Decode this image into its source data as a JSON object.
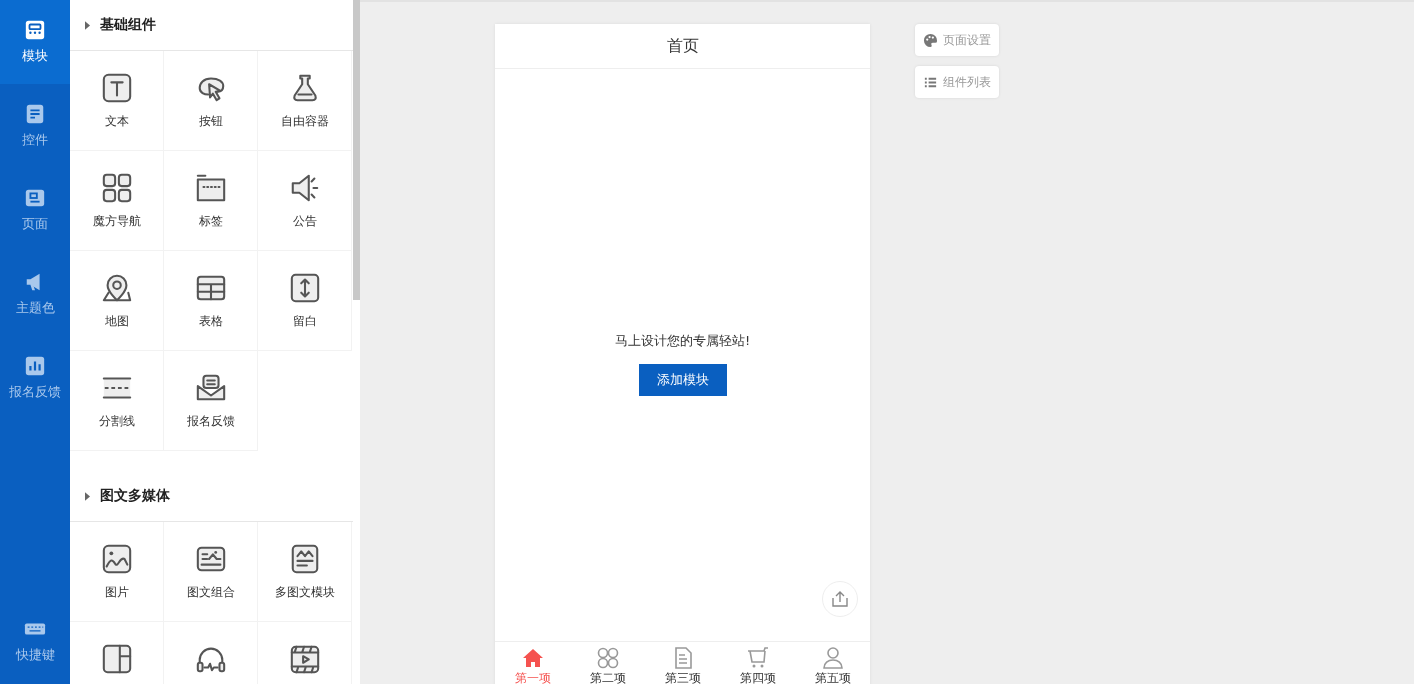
{
  "nav": {
    "items": [
      {
        "label": "模块",
        "selected": true
      },
      {
        "label": "控件",
        "selected": false
      },
      {
        "label": "页面",
        "selected": false
      },
      {
        "label": "主题色",
        "selected": false
      },
      {
        "label": "报名反馈",
        "selected": false
      }
    ],
    "bottom": {
      "label": "快捷键"
    }
  },
  "groups": [
    {
      "title": "基础组件",
      "items": [
        {
          "kind": "labeled",
          "label": "文本"
        },
        {
          "kind": "labeled",
          "label": "按钮"
        },
        {
          "kind": "labeled",
          "label": "自由容器"
        },
        {
          "kind": "labeled",
          "label": "魔方导航"
        },
        {
          "kind": "labeled",
          "label": "标签"
        },
        {
          "kind": "labeled",
          "label": "公告"
        },
        {
          "kind": "labeled",
          "label": "地图"
        },
        {
          "kind": "labeled",
          "label": "表格"
        },
        {
          "kind": "labeled",
          "label": "留白"
        },
        {
          "kind": "labeled",
          "label": "分割线"
        },
        {
          "kind": "labeled",
          "label": "报名反馈"
        }
      ]
    },
    {
      "title": "图文多媒体",
      "items": [
        {
          "kind": "labeled",
          "label": "图片"
        },
        {
          "kind": "labeled",
          "label": "图文组合"
        },
        {
          "kind": "labeled",
          "label": "多图文模块"
        },
        {
          "kind": "icon"
        },
        {
          "kind": "icon"
        },
        {
          "kind": "icon"
        }
      ]
    }
  ],
  "phone": {
    "title": "首页",
    "empty_message": "马上设计您的专属轻站!",
    "add_button": "添加模块",
    "tabs": [
      {
        "label": "第一项",
        "selected": true
      },
      {
        "label": "第二项",
        "selected": false
      },
      {
        "label": "第三项",
        "selected": false
      },
      {
        "label": "第四项",
        "selected": false
      },
      {
        "label": "第五项",
        "selected": false
      }
    ]
  },
  "side_buttons": [
    {
      "label": "页面设置"
    },
    {
      "label": "组件列表"
    }
  ]
}
